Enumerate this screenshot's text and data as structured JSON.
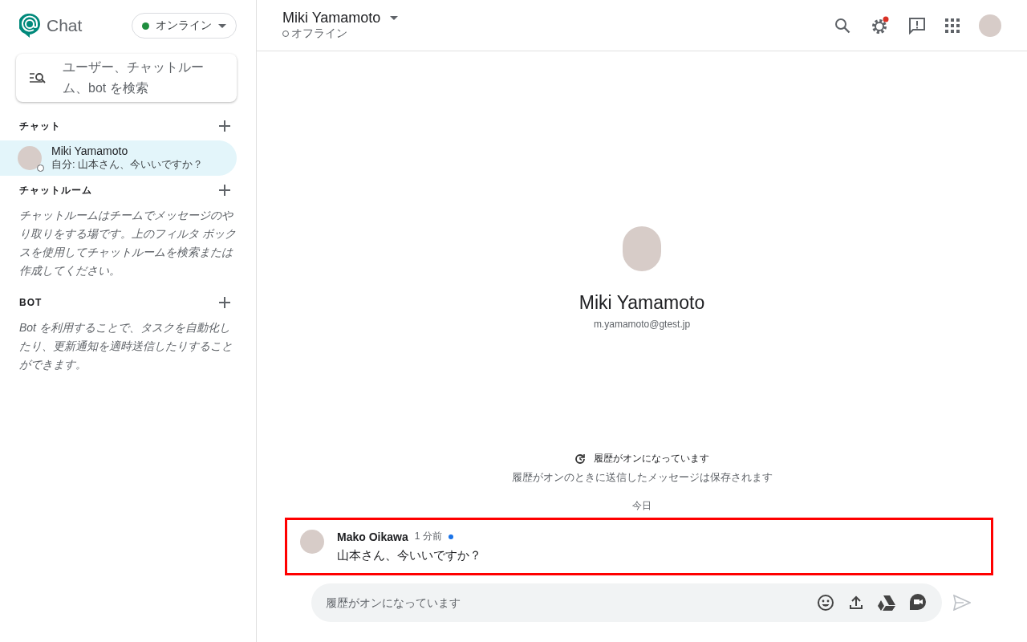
{
  "app": {
    "name": "Chat"
  },
  "status_menu": {
    "label": "オンライン",
    "online": true
  },
  "search": {
    "placeholder": "ユーザー、チャットルーム、bot を検索"
  },
  "sections": [
    {
      "kind": "list",
      "title": "チャット",
      "items": [
        {
          "name": "Miki Yamamoto",
          "preview": "自分: 山本さん、今いいですか？",
          "online": false,
          "selected": true
        }
      ]
    },
    {
      "kind": "note",
      "title": "チャットルーム",
      "text": "チャットルームはチームでメッセージのやり取りをする場です。上のフィルタ ボックスを使用してチャットルームを検索または作成してください。"
    },
    {
      "kind": "note",
      "title": "BOT",
      "text": "Bot を利用することで、タスクを自動化したり、更新通知を適時送信したりすることができます。"
    }
  ],
  "header": {
    "name": "Miki Yamamoto",
    "status": "オフライン",
    "online": false,
    "settings_badge": true
  },
  "profile": {
    "name": "Miki Yamamoto",
    "email": "m.yamamoto@gtest.jp"
  },
  "history": {
    "title": "履歴がオンになっています",
    "subtitle": "履歴がオンのときに送信したメッセージは保存されます"
  },
  "date_divider": "今日",
  "messages": [
    {
      "author": "Mako Oikawa",
      "time": "1 分前",
      "unread": true,
      "text": "山本さん、今いいですか？",
      "highlighted": true
    }
  ],
  "composer": {
    "placeholder": "履歴がオンになっています"
  }
}
